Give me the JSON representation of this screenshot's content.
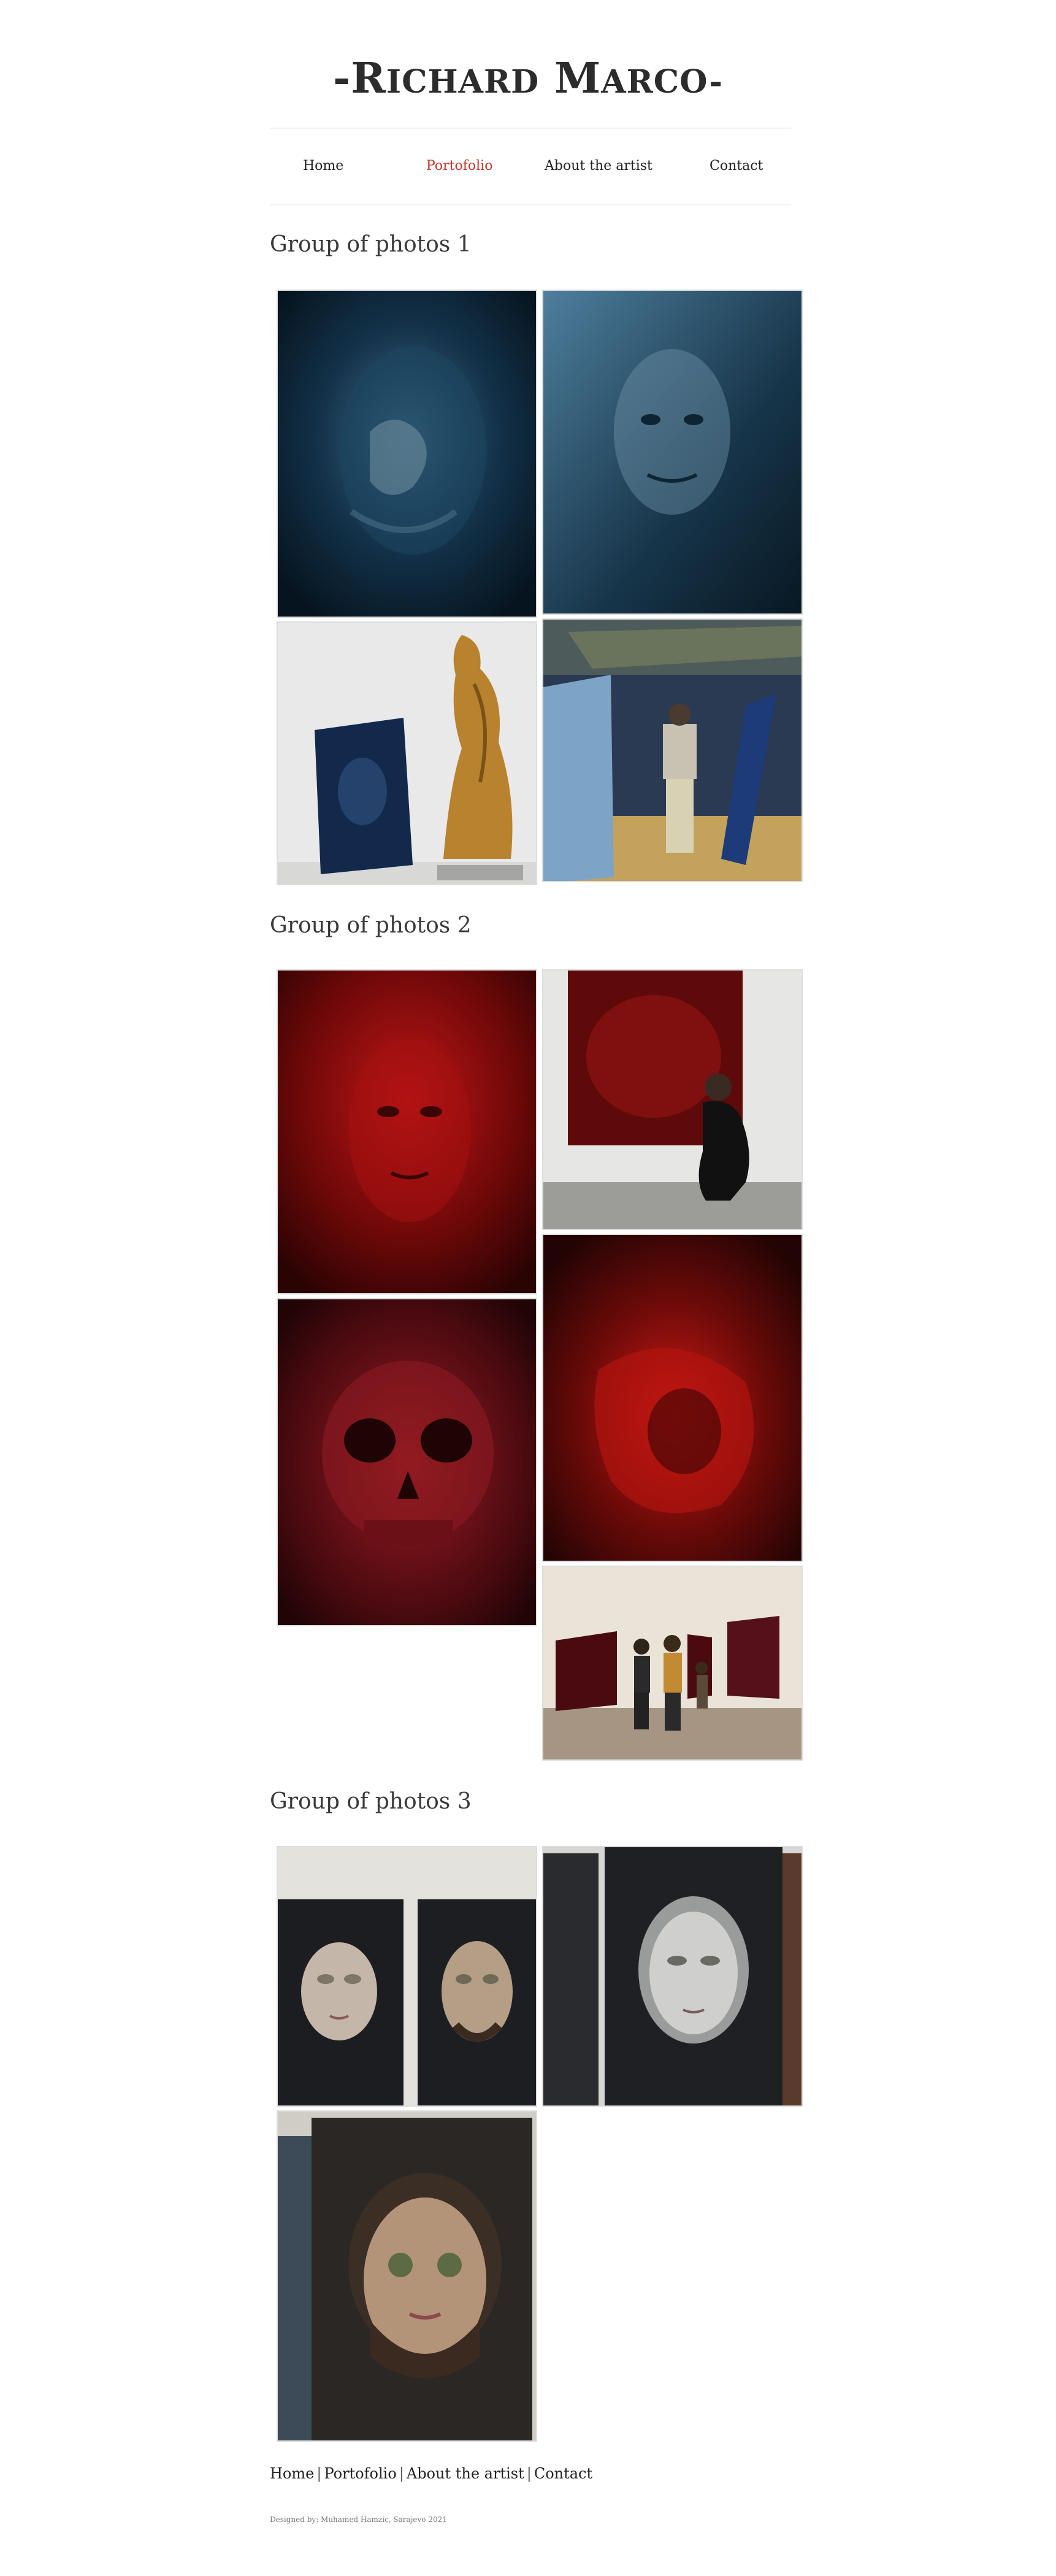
{
  "header": {
    "title_prefix": "-R",
    "title_rest": "ICHARD",
    "title_m": "M",
    "title_rest2": "ARCO-"
  },
  "nav": {
    "items": [
      {
        "label": "Home",
        "active": false
      },
      {
        "label": "Portofolio",
        "active": true
      },
      {
        "label": "About the artist",
        "active": false
      },
      {
        "label": "Contact",
        "active": false
      }
    ],
    "active_color": "#c0392b"
  },
  "groups": [
    {
      "title": "Group of photos 1",
      "photos": [
        {
          "subject": "dark blue abstract painting of face"
        },
        {
          "subject": "blue portrait painting"
        },
        {
          "subject": "golden statue beside blue painting"
        },
        {
          "subject": "installation with blue paintings and person"
        }
      ]
    },
    {
      "title": "Group of photos 2",
      "photos": [
        {
          "subject": "red portrait painting"
        },
        {
          "subject": "artist crouching by red painting"
        },
        {
          "subject": "red skull painting"
        },
        {
          "subject": "red abstract painting"
        },
        {
          "subject": "gallery visitors viewing red paintings"
        }
      ]
    },
    {
      "title": "Group of photos 3",
      "photos": [
        {
          "subject": "two portrait paintings with covered eyes"
        },
        {
          "subject": "portrait of woman with closed eyes"
        },
        {
          "subject": "portrait of bearded man with coins on eyes"
        }
      ]
    }
  ],
  "footer": {
    "links": [
      "Home",
      "Portofolio",
      "About the artist",
      "Contact"
    ],
    "separator": "|",
    "credit": "Designed by: Muhamed Hamzic, Sarajevo 2021"
  }
}
